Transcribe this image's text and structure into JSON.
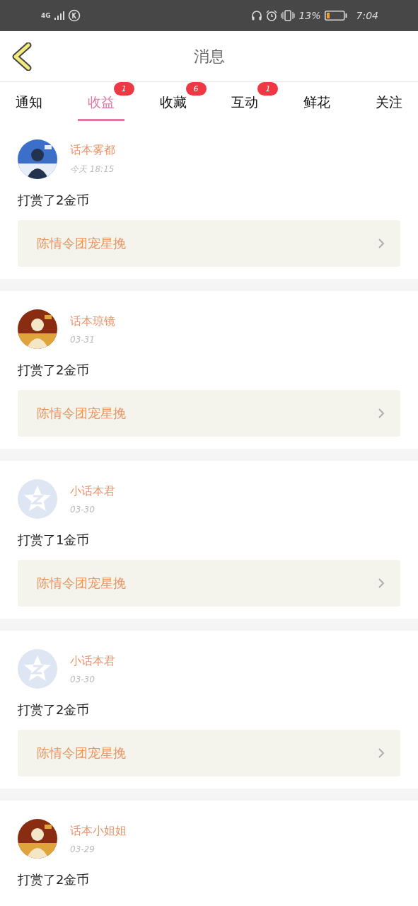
{
  "status_bar": {
    "network": "4G",
    "battery": "13%",
    "time": "7:04"
  },
  "header": {
    "title": "消息"
  },
  "tabs": [
    {
      "label": "通知",
      "selected": false
    },
    {
      "label": "收益",
      "selected": true,
      "badge": "1"
    },
    {
      "label": "收藏",
      "selected": false,
      "badge": "6"
    },
    {
      "label": "互动",
      "selected": false,
      "badge": "1"
    },
    {
      "label": "鲜花",
      "selected": false
    },
    {
      "label": "关注",
      "selected": false
    }
  ],
  "messages": [
    {
      "name": "话本雾都",
      "time": "今天  18:15",
      "text": "打赏了2金币",
      "work": "陈情令团宠星挽"
    },
    {
      "name": "话本琼镜",
      "time": "03-31",
      "text": "打赏了2金币",
      "work": "陈情令团宠星挽"
    },
    {
      "avatar": {
        "kind": "default"
      },
      "name": "小话本君",
      "time": "03-30",
      "text": "打赏了1金币",
      "work": "陈情令团宠星挽"
    },
    {
      "avatar": {
        "kind": "default"
      },
      "name": "小话本君",
      "time": "03-30",
      "text": "打赏了2金币",
      "work": "陈情令团宠星挽"
    },
    {
      "name": "话本小姐姐",
      "time": "03-29",
      "text": "打赏了2金币"
    }
  ]
}
